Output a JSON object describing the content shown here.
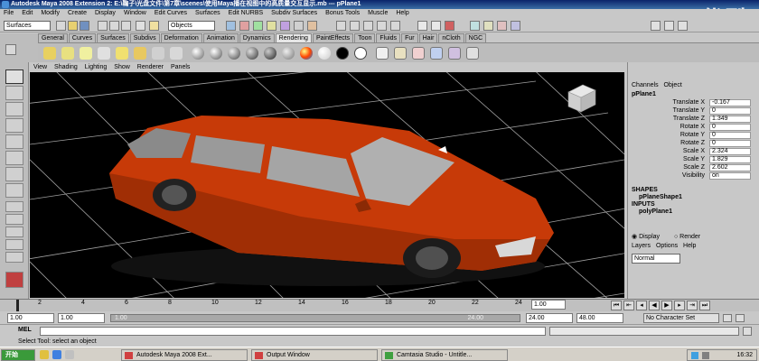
{
  "window": {
    "title": "Autodesk Maya 2008 Extension 2: E:\\鞠子\\光盘文件\\第7章\\scenes\\使用Maya播在视图中的高质量交互显示.mb  ---  pPlane1"
  },
  "watermark": "优酷",
  "menubar": [
    "File",
    "Edit",
    "Modify",
    "Create",
    "Display",
    "Window",
    "Edit Curves",
    "Surfaces",
    "Edit NURBS",
    "Subdiv Surfaces",
    "Bonus Tools",
    "Muscle",
    "Help"
  ],
  "statusline": {
    "mode_value": "Surfaces",
    "selection_mode_value": "Objects"
  },
  "shelf_tabs": [
    "General",
    "Curves",
    "Surfaces",
    "Subdivs",
    "Deformation",
    "Animation",
    "Dynamics",
    "Rendering",
    "PaintEffects",
    "Toon",
    "Fluids",
    "Fur",
    "Hair",
    "nCloth",
    "NGC"
  ],
  "shelf_active_tab": "Rendering",
  "viewport_menu": [
    "View",
    "Shading",
    "Lighting",
    "Show",
    "Renderer",
    "Panels"
  ],
  "channelbox": {
    "tabs": [
      "Channels",
      "Object"
    ],
    "object_name": "pPlane1",
    "attributes": [
      {
        "label": "Translate X",
        "value": "-0.167"
      },
      {
        "label": "Translate Y",
        "value": "0"
      },
      {
        "label": "Translate Z",
        "value": "1.349"
      },
      {
        "label": "Rotate X",
        "value": "0"
      },
      {
        "label": "Rotate Y",
        "value": "0"
      },
      {
        "label": "Rotate Z",
        "value": "0"
      },
      {
        "label": "Scale X",
        "value": "2.324"
      },
      {
        "label": "Scale Y",
        "value": "1.829"
      },
      {
        "label": "Scale Z",
        "value": "2.602"
      },
      {
        "label": "Visibility",
        "value": "on"
      }
    ],
    "shapes_header": "SHAPES",
    "shape_name": "pPlaneShape1",
    "inputs_header": "INPUTS",
    "input_name": "polyPlane1",
    "display_label": "Display",
    "render_label": "Render",
    "layer_menu": [
      "Layers",
      "Options",
      "Help"
    ],
    "layer_blend_value": "Normal"
  },
  "timeslider": {
    "ticks": [
      "2",
      "4",
      "6",
      "8",
      "10",
      "12",
      "14",
      "16",
      "18",
      "20",
      "22",
      "24"
    ],
    "current_frame": "1.00"
  },
  "rangeslider": {
    "start_time": "1.00",
    "playback_start": "1.00",
    "range_start_label": "1.00",
    "range_end_label": "24.00",
    "playback_end": "24.00",
    "end_time": "48.00",
    "character_set": "No Character Set"
  },
  "mel": {
    "label": "MEL"
  },
  "helpline": "Select Tool: select an object",
  "taskbar": {
    "start_label": "开始",
    "items": [
      "Autodesk Maya 2008 Ext...",
      "Output Window",
      "Camtasia Studio - Untitle..."
    ],
    "clock": "16:32"
  },
  "colors": {
    "viewport_bg": "#000000",
    "car_body": "#d0400a",
    "grid": "#d0d0d0",
    "title_bg": "#0a246a"
  }
}
